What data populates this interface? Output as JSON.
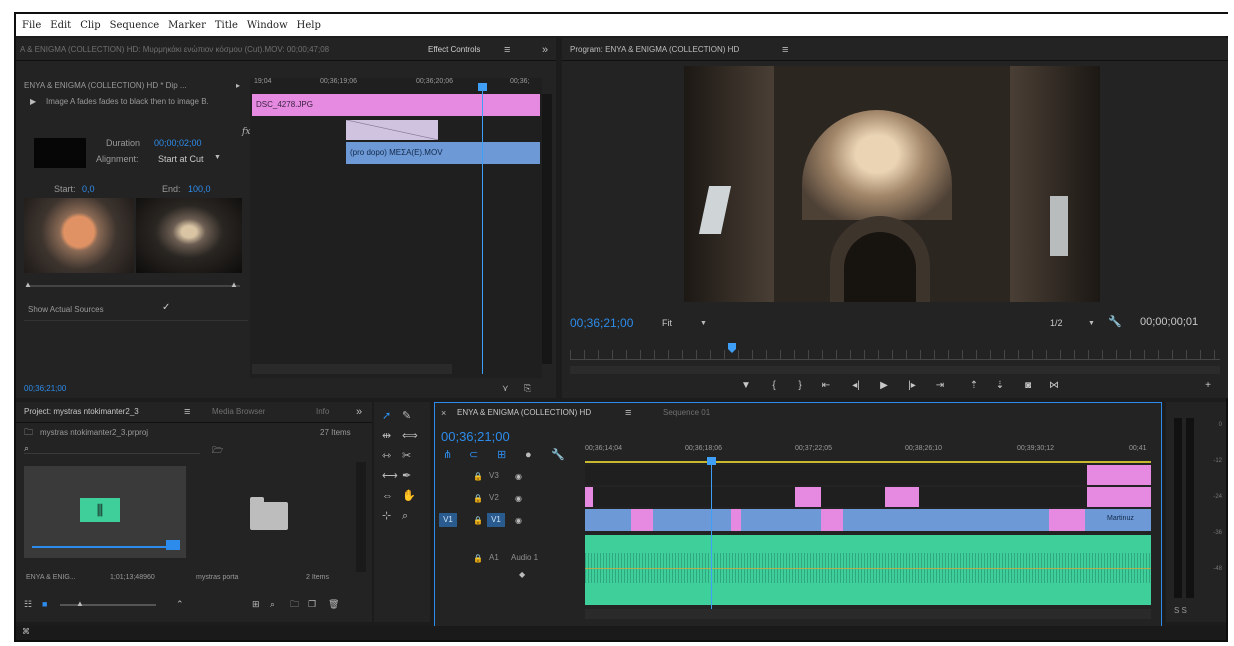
{
  "menu": [
    "File",
    "Edit",
    "Clip",
    "Sequence",
    "Marker",
    "Title",
    "Window",
    "Help"
  ],
  "source_panel": {
    "tab_title": "A & ENIGMA (COLLECTION) HD: Μυρμηκάκι ενώπιον κόσμου (Cut).MOV: 00;00;47;08",
    "effect_controls_tab": "Effect Controls",
    "seq_label": "ENYA & ENIGMA (COLLECTION) HD * Dip ...",
    "description": "Image A fades fades to black then to image B.",
    "duration_label": "Duration",
    "duration_value": "00;00;02;00",
    "alignment_label": "Alignment:",
    "alignment_value": "Start at Cut",
    "start_label": "Start:",
    "start_value": "0,0",
    "end_label": "End:",
    "end_value": "100,0",
    "show_actual_label": "Show Actual Sources",
    "timecode": "00;36;21;00",
    "ruler": [
      "19;04",
      "00;36;19;06",
      "00;36;20;06",
      "00;36;"
    ],
    "clip_a": "DSC_4278.JPG",
    "clip_b": "(pro dopo) ΜΕΣΑ(Ε).MOV"
  },
  "program_panel": {
    "title": "Program: ENYA & ENIGMA (COLLECTION) HD",
    "timecode": "00;36;21;00",
    "fit": "Fit",
    "resolution": "1/2",
    "duration": "00;00;00;01"
  },
  "project_panel": {
    "tab_project": "Project: mystras ntokimanter2_3",
    "tab_media": "Media Browser",
    "tab_info": "Info",
    "file": "mystras ntokimanter2_3.prproj",
    "items_count": "27 Items",
    "item1_name": "ENYA & ENIG...",
    "item1_dur": "1;01;13;48960",
    "item2_name": "mystras porta",
    "item2_count": "2 Items"
  },
  "timeline": {
    "tab_title": "ENYA & ENIGMA (COLLECTION) HD",
    "tab_seq": "Sequence 01",
    "timecode": "00;36;21;00",
    "ruler": [
      "00;36;14;04",
      "00;36;18;06",
      "00;37;22;05",
      "00;38;26;10",
      "00;39;30;12",
      "00;41"
    ],
    "tracks": [
      "V3",
      "V2",
      "V1",
      "A1"
    ],
    "v1_src": "V1",
    "audio_name": "Audio 1",
    "clip_end_label": "Martinuz"
  },
  "meter": {
    "labels": [
      "0",
      "-12",
      "-24",
      "-36",
      "-48"
    ],
    "solo": "S S"
  },
  "colors": {
    "accent": "#2d8ceb",
    "video_pink": "#e58ae0",
    "video_blue": "#6d9ad6",
    "audio_green": "#3ecf9b",
    "playhead": "#3f9ef5"
  }
}
